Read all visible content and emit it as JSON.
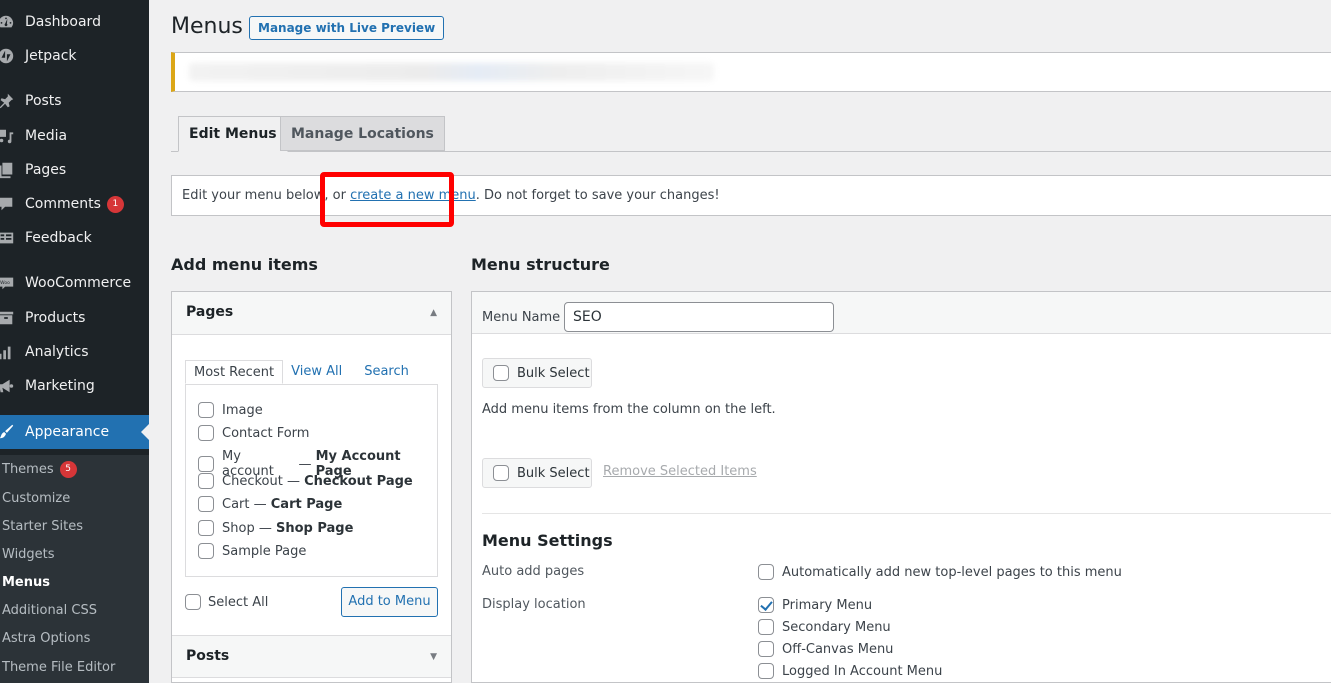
{
  "sidebar": {
    "items": [
      {
        "label": "Dashboard",
        "icon": "dashboard-icon"
      },
      {
        "label": "Jetpack",
        "icon": "jetpack-icon"
      },
      {
        "label": "Posts",
        "icon": "pin-icon"
      },
      {
        "label": "Media",
        "icon": "media-icon"
      },
      {
        "label": "Pages",
        "icon": "pages-icon"
      },
      {
        "label": "Comments",
        "icon": "comment-icon",
        "badge": "1"
      },
      {
        "label": "Feedback",
        "icon": "feedback-icon"
      },
      {
        "label": "WooCommerce",
        "icon": "woo-icon"
      },
      {
        "label": "Products",
        "icon": "archive-icon"
      },
      {
        "label": "Analytics",
        "icon": "chart-bar-icon"
      },
      {
        "label": "Marketing",
        "icon": "megaphone-icon"
      },
      {
        "label": "Appearance",
        "icon": "paintbrush-icon",
        "active": true
      }
    ],
    "submenu": [
      {
        "label": "Themes",
        "badge": "5"
      },
      {
        "label": "Customize"
      },
      {
        "label": "Starter Sites"
      },
      {
        "label": "Widgets"
      },
      {
        "label": "Menus",
        "current": true
      },
      {
        "label": "Additional CSS"
      },
      {
        "label": "Astra Options"
      },
      {
        "label": "Theme File Editor"
      }
    ]
  },
  "header": {
    "title": "Menus",
    "live_preview_label": "Manage with Live Preview"
  },
  "tabs": [
    {
      "label": "Edit Menus",
      "active": true
    },
    {
      "label": "Manage Locations",
      "active": false
    }
  ],
  "manage": {
    "before": "Edit your menu below, or ",
    "link": "create a new menu",
    "after": ". Do not forget to save your changes!"
  },
  "add_items": {
    "title": "Add menu items",
    "pages_section": {
      "title": "Pages",
      "tabs": [
        "Most Recent",
        "View All",
        "Search"
      ],
      "items": [
        {
          "label": "Image",
          "state": ""
        },
        {
          "label": "Contact Form",
          "state": ""
        },
        {
          "label": "My account",
          "state": "My Account Page"
        },
        {
          "label": "Checkout",
          "state": "Checkout Page"
        },
        {
          "label": "Cart",
          "state": "Cart Page"
        },
        {
          "label": "Shop",
          "state": "Shop Page"
        },
        {
          "label": "Sample Page",
          "state": ""
        }
      ],
      "select_all": "Select All",
      "add_button": "Add to Menu"
    },
    "posts_section": {
      "title": "Posts"
    }
  },
  "structure": {
    "title": "Menu structure",
    "menu_name_label": "Menu Name",
    "menu_name_value": "SEO",
    "bulk_select": "Bulk Select",
    "hint": "Add menu items from the column on the left.",
    "remove_selected": "Remove Selected Items",
    "settings": {
      "title": "Menu Settings",
      "auto_add_label": "Auto add pages",
      "auto_add_option": "Automatically add new top-level pages to this menu",
      "auto_add_checked": false,
      "display_location_label": "Display location",
      "locations": [
        {
          "label": "Primary Menu",
          "checked": true
        },
        {
          "label": "Secondary Menu",
          "checked": false
        },
        {
          "label": "Off-Canvas Menu",
          "checked": false
        },
        {
          "label": "Logged In Account Menu",
          "checked": false
        }
      ]
    }
  },
  "colors": {
    "accent": "#2271b1",
    "sidebar_bg": "#1d2327",
    "badge": "#d63638",
    "highlight": "#ff0000",
    "notice_border": "#dba617"
  }
}
